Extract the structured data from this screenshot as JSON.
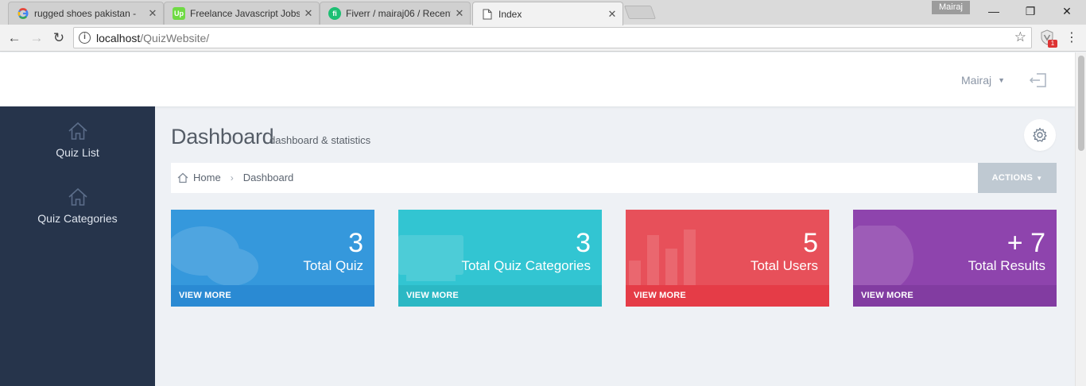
{
  "browser": {
    "tabs": [
      {
        "title": "rugged shoes pakistan -",
        "favicon": "google-icon",
        "favicon_color": "#ffffff"
      },
      {
        "title": "Freelance Javascript Jobs",
        "favicon": "upwork-icon",
        "favicon_text": "Up",
        "favicon_color": "#6fda44"
      },
      {
        "title": "Fiverr / mairaj06 / Recent",
        "favicon": "fiverr-icon",
        "favicon_text": "fi",
        "favicon_color": "#1dbf73"
      },
      {
        "title": "Index",
        "favicon": "page-icon"
      }
    ],
    "profile_name": "Mairaj",
    "address": {
      "host": "localhost",
      "path": "/QuizWebsite/"
    },
    "extension_badge": "1"
  },
  "header": {
    "username": "Mairaj"
  },
  "sidebar": {
    "items": [
      {
        "label": "Quiz List",
        "icon": "home-icon"
      },
      {
        "label": "Quiz Categories",
        "icon": "home-icon"
      }
    ]
  },
  "main": {
    "title": "Dashboard",
    "subtitle": "dashboard & statistics",
    "breadcrumb": [
      "Home",
      "Dashboard"
    ],
    "actions_label": "ACTIONS"
  },
  "tiles": [
    {
      "value": "3",
      "label": "Total Quiz",
      "more": "VIEW MORE",
      "color": "#3598dc",
      "footer_color": "#2a8ad3",
      "icon": "comments-icon"
    },
    {
      "value": "3",
      "label": "Total Quiz Categories",
      "more": "VIEW MORE",
      "color": "#32c5d2",
      "footer_color": "#2bb8c4",
      "icon": "monitor-icon"
    },
    {
      "value": "5",
      "label": "Total Users",
      "more": "VIEW MORE",
      "color": "#e7505a",
      "footer_color": "#e53c47",
      "icon": "bar-chart-icon"
    },
    {
      "value": "+ 7",
      "label": "Total Results",
      "more": "VIEW MORE",
      "color": "#8e44ad",
      "footer_color": "#823ca1",
      "icon": "globe-icon"
    }
  ],
  "colors": {
    "sidebar_bg": "#26344b",
    "page_bg": "#eef1f5"
  }
}
